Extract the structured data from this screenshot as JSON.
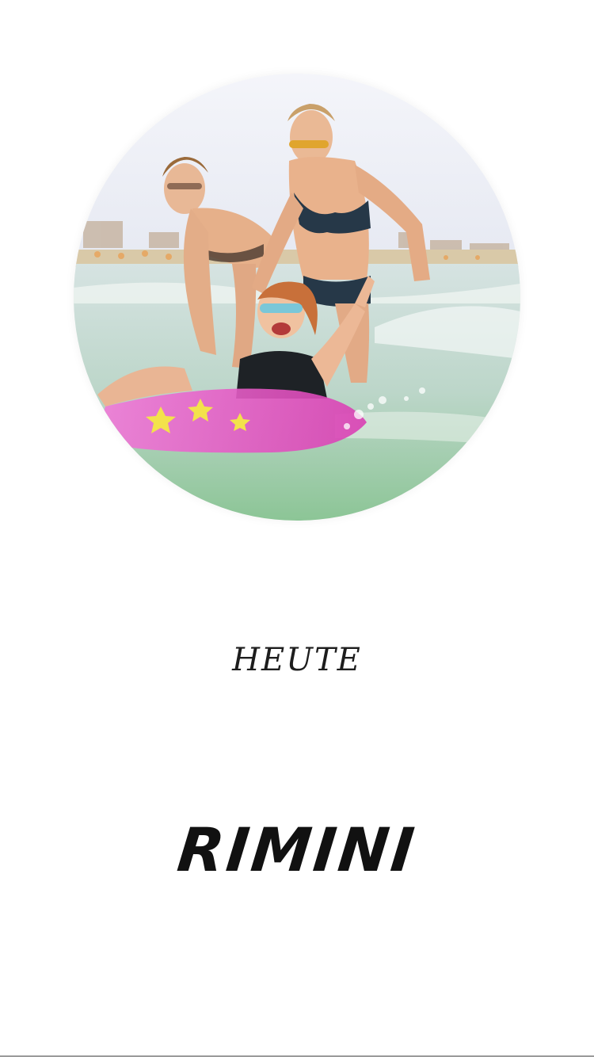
{
  "story": {
    "photo": {
      "description_icon": "beach-photo",
      "colors": {
        "sky": "#eef0f6",
        "sea": "#bcd6c9",
        "sea_deep": "#8cc596",
        "float_ring": "#e24fbf",
        "star": "#f3e24b",
        "swimsuit": "#263848"
      }
    },
    "subtitle": "HEUTE",
    "title": "RIMINI"
  }
}
